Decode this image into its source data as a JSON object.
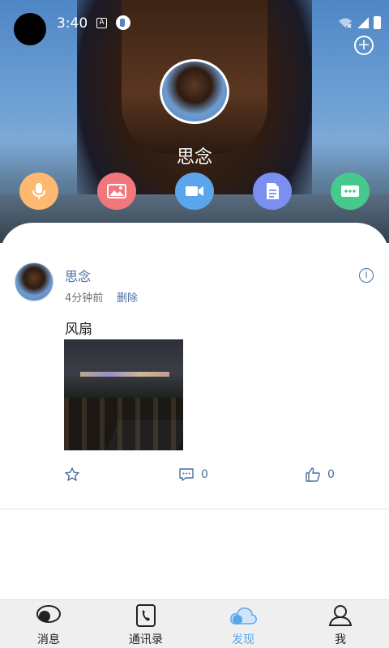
{
  "status_bar": {
    "time": "3:40",
    "icon_a": "A"
  },
  "header": {
    "add_icon": "plus-circle-icon",
    "profile_name": "思念"
  },
  "quick_actions": [
    {
      "name": "voice",
      "icon": "microphone-icon",
      "color": "#ffb870"
    },
    {
      "name": "image",
      "icon": "image-icon",
      "color": "#f2777d"
    },
    {
      "name": "video",
      "icon": "video-camera-icon",
      "color": "#5aa5ec"
    },
    {
      "name": "file",
      "icon": "document-icon",
      "color": "#7a8ff0"
    },
    {
      "name": "message",
      "icon": "chat-bubble-icon",
      "color": "#46c98c"
    }
  ],
  "post": {
    "author": "思念",
    "time": "4分钟前",
    "delete_label": "删除",
    "text": "风扇",
    "comment_count": "0",
    "like_count": "0"
  },
  "tabs": [
    {
      "label": "消息",
      "icon": "message-bubble-icon",
      "active": false
    },
    {
      "label": "通讯录",
      "icon": "contacts-book-icon",
      "active": false
    },
    {
      "label": "发现",
      "icon": "cloud-icon",
      "active": true
    },
    {
      "label": "我",
      "icon": "person-icon",
      "active": false
    }
  ],
  "colors": {
    "accent": "#5aa5ec",
    "link": "#4a6fa0"
  }
}
